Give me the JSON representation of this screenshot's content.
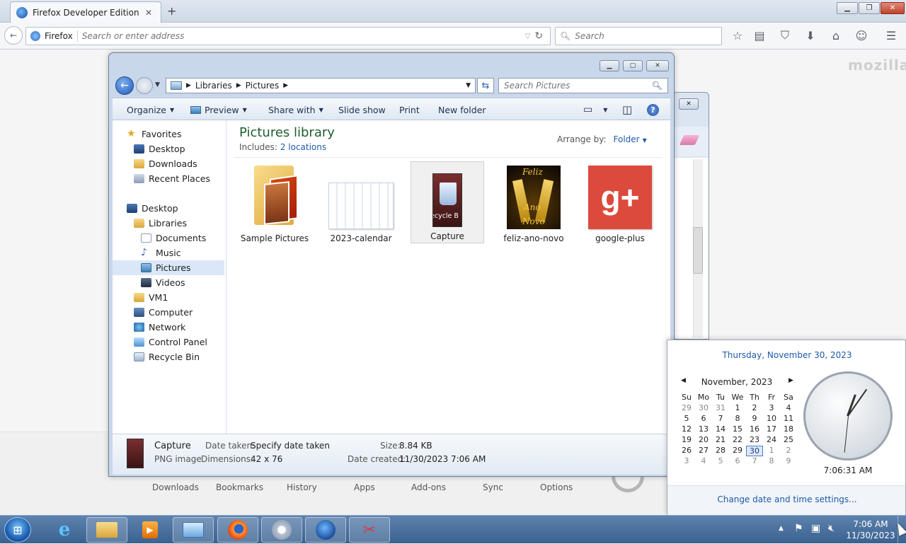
{
  "firefox": {
    "tab_title": "Firefox Developer Edition S...",
    "identity_label": "Firefox",
    "url_placeholder": "Search or enter address",
    "search_placeholder": "Search",
    "watermark": "mozilla",
    "bottom_links": [
      "Downloads",
      "Bookmarks",
      "History",
      "Apps",
      "Add-ons",
      "Sync",
      "Options"
    ]
  },
  "explorer": {
    "breadcrumb": [
      "Libraries",
      "Pictures"
    ],
    "search_placeholder": "Search Pictures",
    "toolbar": {
      "organize": "Organize",
      "preview": "Preview",
      "share_with": "Share with",
      "slide_show": "Slide show",
      "print": "Print",
      "new_folder": "New folder"
    },
    "nav": [
      {
        "label": "Favorites",
        "icon": "star-icon"
      },
      {
        "label": "Desktop",
        "icon": "desktop-icon"
      },
      {
        "label": "Downloads",
        "icon": "downloads-folder-icon"
      },
      {
        "label": "Recent Places",
        "icon": "recent-places-icon"
      },
      {
        "label": "Desktop",
        "icon": "desktop-icon"
      },
      {
        "label": "Libraries",
        "icon": "libraries-icon"
      },
      {
        "label": "Documents",
        "icon": "documents-icon"
      },
      {
        "label": "Music",
        "icon": "music-icon"
      },
      {
        "label": "Pictures",
        "icon": "pictures-icon"
      },
      {
        "label": "Videos",
        "icon": "videos-icon"
      },
      {
        "label": "VM1",
        "icon": "user-folder-icon"
      },
      {
        "label": "Computer",
        "icon": "computer-icon"
      },
      {
        "label": "Network",
        "icon": "network-icon"
      },
      {
        "label": "Control Panel",
        "icon": "control-panel-icon"
      },
      {
        "label": "Recycle Bin",
        "icon": "recycle-bin-icon"
      }
    ],
    "library_title": "Pictures library",
    "includes_label": "Includes:",
    "includes_link": "2 locations",
    "arrange_label": "Arrange by:",
    "arrange_value": "Folder",
    "items": [
      {
        "label": "Sample Pictures"
      },
      {
        "label": "2023-calendar"
      },
      {
        "label": "Capture",
        "thumb_text": "ecycle B"
      },
      {
        "label": "feliz-ano-novo",
        "thumb_text_1": "Feliz",
        "thumb_text_2": "Ano",
        "thumb_text_3": "Novo"
      },
      {
        "label": "google-plus",
        "thumb_text": "g+"
      }
    ],
    "details": {
      "name": "Capture",
      "type": "PNG image",
      "date_taken_label": "Date taken:",
      "date_taken_value": "Specify date taken",
      "dimensions_label": "Dimensions:",
      "dimensions_value": "42 x 76",
      "size_label": "Size:",
      "size_value": "8.84 KB",
      "date_created_label": "Date created:",
      "date_created_value": "11/30/2023 7:06 AM"
    }
  },
  "calendar": {
    "full_date": "Thursday, November 30, 2023",
    "month_label": "November, 2023",
    "weekdays": [
      "Su",
      "Mo",
      "Tu",
      "We",
      "Th",
      "Fr",
      "Sa"
    ],
    "weeks": [
      [
        "29",
        "30",
        "31",
        "1",
        "2",
        "3",
        "4"
      ],
      [
        "5",
        "6",
        "7",
        "8",
        "9",
        "10",
        "11"
      ],
      [
        "12",
        "13",
        "14",
        "15",
        "16",
        "17",
        "18"
      ],
      [
        "19",
        "20",
        "21",
        "22",
        "23",
        "24",
        "25"
      ],
      [
        "26",
        "27",
        "28",
        "29",
        "30",
        "1",
        "2"
      ],
      [
        "3",
        "4",
        "5",
        "6",
        "7",
        "8",
        "9"
      ]
    ],
    "today": "30",
    "clock_time": "7:06:31 AM",
    "settings_link": "Change date and time settings..."
  },
  "taskbar": {
    "time": "7:06 AM",
    "date": "11/30/2023"
  }
}
